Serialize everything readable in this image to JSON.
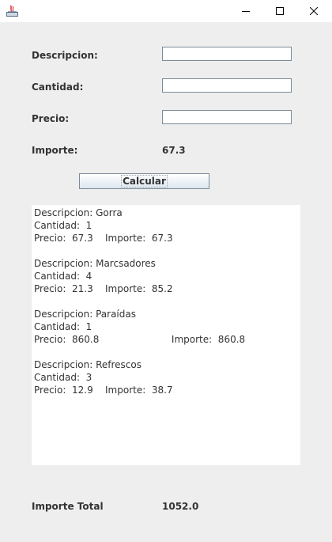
{
  "form": {
    "descripcion_label": "Descripcion:",
    "descripcion_value": "",
    "cantidad_label": "Cantidad:",
    "cantidad_value": "",
    "precio_label": "Precio:",
    "precio_value": "",
    "importe_label": "Importe:",
    "importe_value": "67.3",
    "calcular_label": "Calcular"
  },
  "output": {
    "records": [
      {
        "descripcion_line": "Descripcion: Gorra",
        "cantidad_line": "Cantidad:  1",
        "precio_importe_line": "Precio:  67.3    Importe:  67.3"
      },
      {
        "descripcion_line": "Descripcion: Marcsadores",
        "cantidad_line": "Cantidad:  4",
        "precio_importe_line": "Precio:  21.3    Importe:  85.2"
      },
      {
        "descripcion_line": "Descripcion: Paraídas",
        "cantidad_line": "Cantidad:  1",
        "precio_importe_line": "Precio:  860.8                        Importe:  860.8"
      },
      {
        "descripcion_line": "Descripcion: Refrescos",
        "cantidad_line": "Cantidad:  3",
        "precio_importe_line": "Precio:  12.9    Importe:  38.7"
      }
    ]
  },
  "total": {
    "label": "Importe Total",
    "value": "1052.0"
  },
  "icons": {
    "app": "java-icon",
    "minimize": "minimize-icon",
    "maximize": "maximize-icon",
    "close": "close-icon"
  }
}
